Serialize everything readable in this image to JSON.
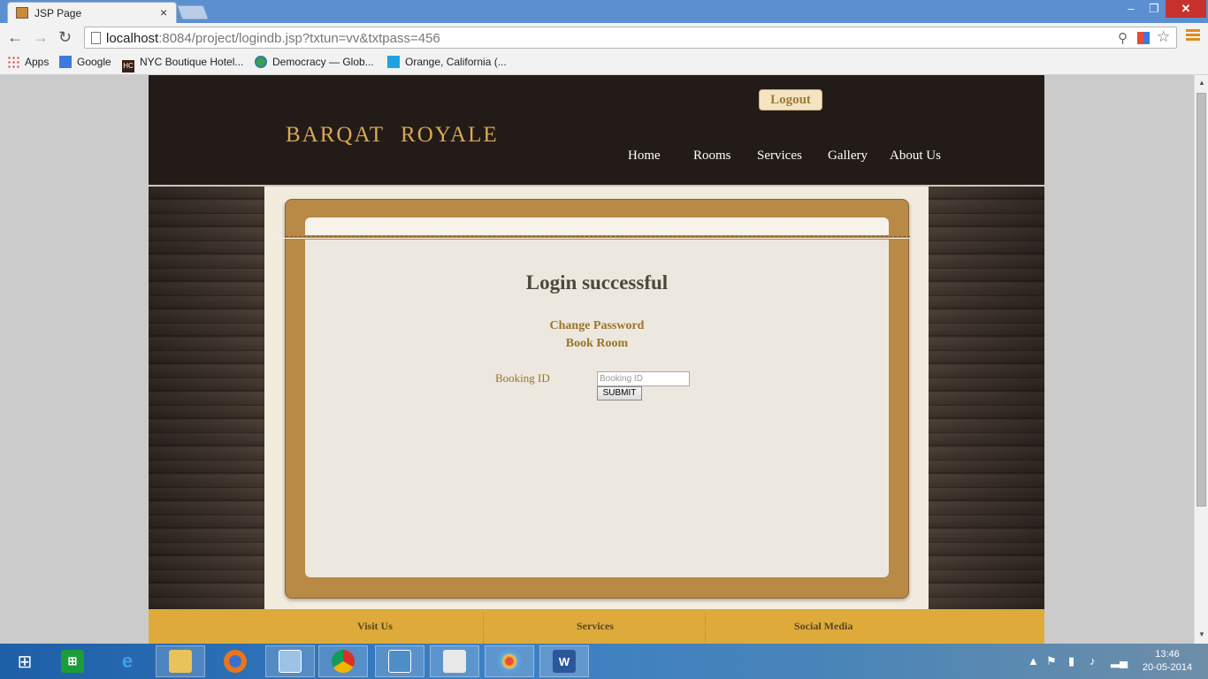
{
  "browser": {
    "tab_title": "JSP Page",
    "tab_close": "×",
    "url_host": "localhost",
    "url_rest": ":8084/project/logindb.jsp?txtun=vv&txtpass=456",
    "window_controls": {
      "minimize": "–",
      "maximize": "❐",
      "close": "✕"
    },
    "nav": {
      "back": "←",
      "forward": "→",
      "reload": "↻"
    },
    "bookmarks": [
      {
        "label": "Apps",
        "icon": "apps-icon"
      },
      {
        "label": "Google",
        "icon": "google-icon"
      },
      {
        "label": "NYC Boutique Hotel...",
        "icon": "hc-icon"
      },
      {
        "label": "Democracy — Glob...",
        "icon": "globe-icon"
      },
      {
        "label": "Orange, California (...",
        "icon": "f-icon"
      }
    ],
    "hc_icon_text": "HC"
  },
  "site": {
    "logo_word1": "BARQAT",
    "logo_word2": "ROYALE",
    "logout_label": "Logout",
    "menu": [
      "Home",
      "Rooms",
      "Services",
      "Gallery",
      "About Us"
    ],
    "login_message": "Login successful",
    "change_password_link": "Change Password",
    "book_room_link": "Book Room",
    "booking_label": "Booking ID",
    "booking_placeholder": "Booking ID",
    "booking_value": "",
    "submit_label": "SUBMIT",
    "footer": [
      "Visit Us",
      "Services",
      "Social Media"
    ]
  },
  "taskbar": {
    "clock_time": "13:46",
    "clock_date": "20-05-2014"
  },
  "colors": {
    "header_bg": "#231b18",
    "logo_gold": "#d8a955",
    "frame_brown": "#b98a45",
    "link_gold": "#9a7428",
    "footer_gold": "#deab3a"
  }
}
